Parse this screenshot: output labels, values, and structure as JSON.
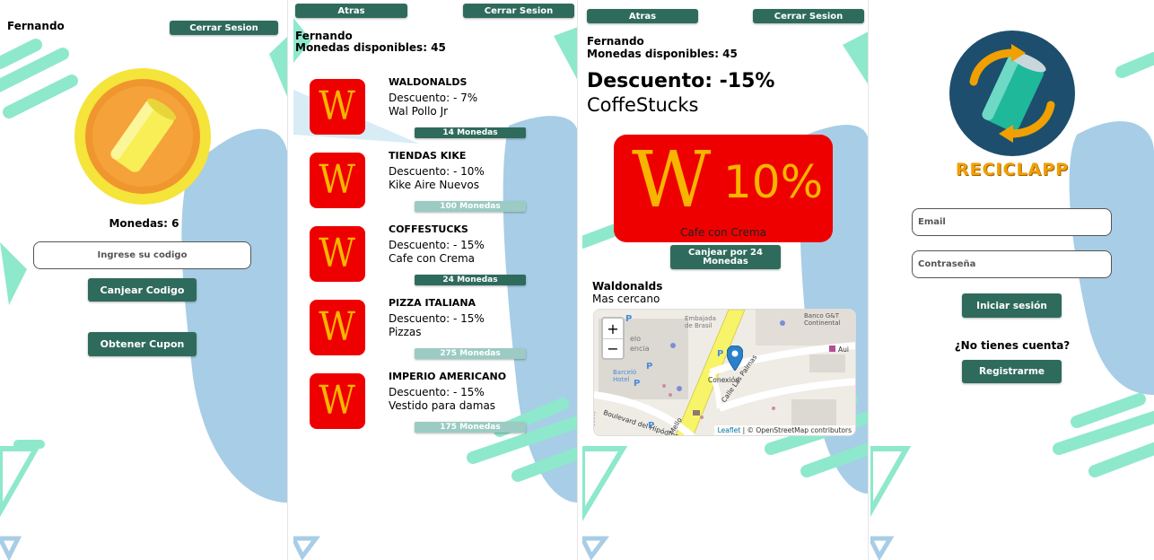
{
  "colors": {
    "primary_button": "#2f6b5c",
    "muted_button": "#9bcbc3",
    "brand_red": "#ef0000",
    "brand_yellow": "#f7b500",
    "accent_mint": "#8ee8cc",
    "accent_blue": "#a8cde6",
    "logo_orange": "#f0a000"
  },
  "screen1": {
    "user_name": "Fernando",
    "logout_label": "Cerrar Sesion",
    "coins_label": "Monedas: 6",
    "code_placeholder": "Ingrese su codigo",
    "redeem_code_label": "Canjear Codigo",
    "get_coupon_label": "Obtener Cupon",
    "coin_icon": "soda-can-coin-icon"
  },
  "screen2": {
    "back_label": "Atras",
    "logout_label": "Cerrar Sesion",
    "user_name": "Fernando",
    "coins_available": "Monedas disponibles: 45",
    "offers": [
      {
        "store": "WALDONALDS",
        "discount": "Descuento: - 7%",
        "item": "Wal Pollo Jr",
        "cost": "14 Monedas",
        "affordable": true
      },
      {
        "store": "TIENDAS KIKE",
        "discount": "Descuento: - 10%",
        "item": "Kike Aire Nuevos",
        "cost": "100 Monedas",
        "affordable": false
      },
      {
        "store": "COFFESTUCKS",
        "discount": "Descuento: - 15%",
        "item": "Cafe con Crema",
        "cost": "24 Monedas",
        "affordable": true
      },
      {
        "store": "PIZZA ITALIANA",
        "discount": "Descuento: - 15%",
        "item": "Pizzas",
        "cost": "275 Monedas",
        "affordable": false
      },
      {
        "store": "IMPERIO AMERICANO",
        "discount": "Descuento: - 15%",
        "item": "Vestido para damas",
        "cost": "175 Monedas",
        "affordable": false
      }
    ],
    "logo_glyph": "W"
  },
  "screen3": {
    "back_label": "Atras",
    "logout_label": "Cerrar Sesion",
    "user_name": "Fernando",
    "coins_available": "Monedas disponibles: 45",
    "discount_title": "Descuento: -15%",
    "store_name": "CoffeStucks",
    "coupon_glyph": "W",
    "coupon_percent": "10%",
    "coupon_item": "Cafe con Crema",
    "redeem_label": "Canjear por 24 Monedas",
    "nearest_store": "Waldonalds",
    "nearest_label": "Mas cercano",
    "map": {
      "zoom_in": "+",
      "zoom_out": "−",
      "labels": [
        "Embajada de Brasil",
        "Banco G&T Continental",
        "Barceló Hotel",
        "Boulevard del Hipódromo",
        "Conexión",
        "Calle Las Palmas",
        "Aui",
        "elo",
        "encia",
        "Mello",
        "lonas",
        "P",
        "P",
        "P",
        "P",
        "P"
      ],
      "attribution_leaflet": "Leaflet",
      "attribution_rest": "| © OpenStreetMap contributors",
      "osm": "OpenStreetMap"
    }
  },
  "screen4": {
    "app_name": "RECICLAPP",
    "email_placeholder": "Email",
    "password_placeholder": "Contraseña",
    "login_label": "Iniciar sesión",
    "no_account": "¿No tienes cuenta?",
    "register_label": "Registrarme",
    "logo_icon": "recycle-can-icon"
  }
}
